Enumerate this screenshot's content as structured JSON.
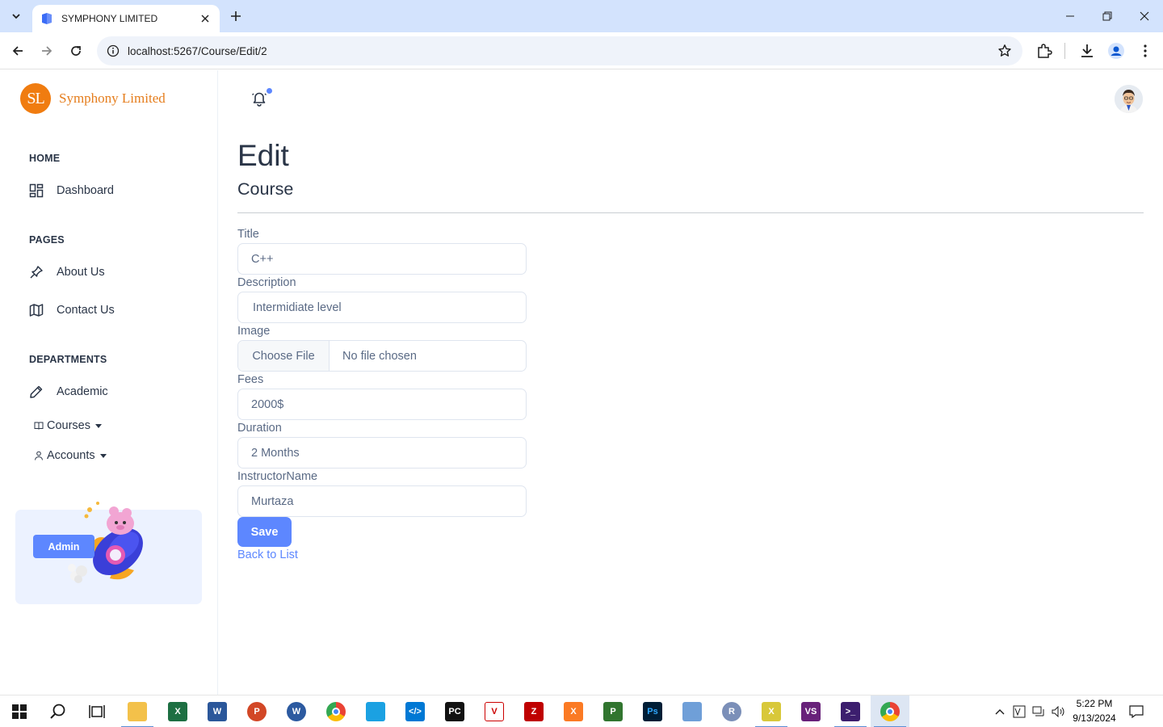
{
  "browser": {
    "tab_title": "SYMPHONY LIMITED",
    "url": "localhost:5267/Course/Edit/2"
  },
  "sidebar": {
    "brand_logo": "SL",
    "brand_name": "Symphony Limited",
    "sections": {
      "home": "HOME",
      "pages": "PAGES",
      "departments": "DEPARTMENTS"
    },
    "items": {
      "dashboard": "Dashboard",
      "about": "About Us",
      "contact": "Contact Us",
      "academic": "Academic",
      "courses": "Courses",
      "accounts": "Accounts"
    },
    "promo_button": "Admin"
  },
  "page": {
    "title": "Edit",
    "subtitle": "Course",
    "form": {
      "title_label": "Title",
      "title_value": "C++",
      "description_label": "Description",
      "description_value": "Intermidiate level",
      "image_label": "Image",
      "file_button": "Choose File",
      "file_status": "No file chosen",
      "fees_label": "Fees",
      "fees_value": "2000$",
      "duration_label": "Duration",
      "duration_value": "2 Months",
      "instructor_label": "InstructorName",
      "instructor_value": "Murtaza",
      "save_label": "Save",
      "back_label": "Back to List"
    }
  },
  "taskbar": {
    "time": "5:22 PM",
    "date": "9/13/2024"
  },
  "colors": {
    "primary": "#5d87ff",
    "brand_orange": "#f07c10",
    "tabbar": "#d3e3fd",
    "promo_bg": "#ecf2ff"
  }
}
